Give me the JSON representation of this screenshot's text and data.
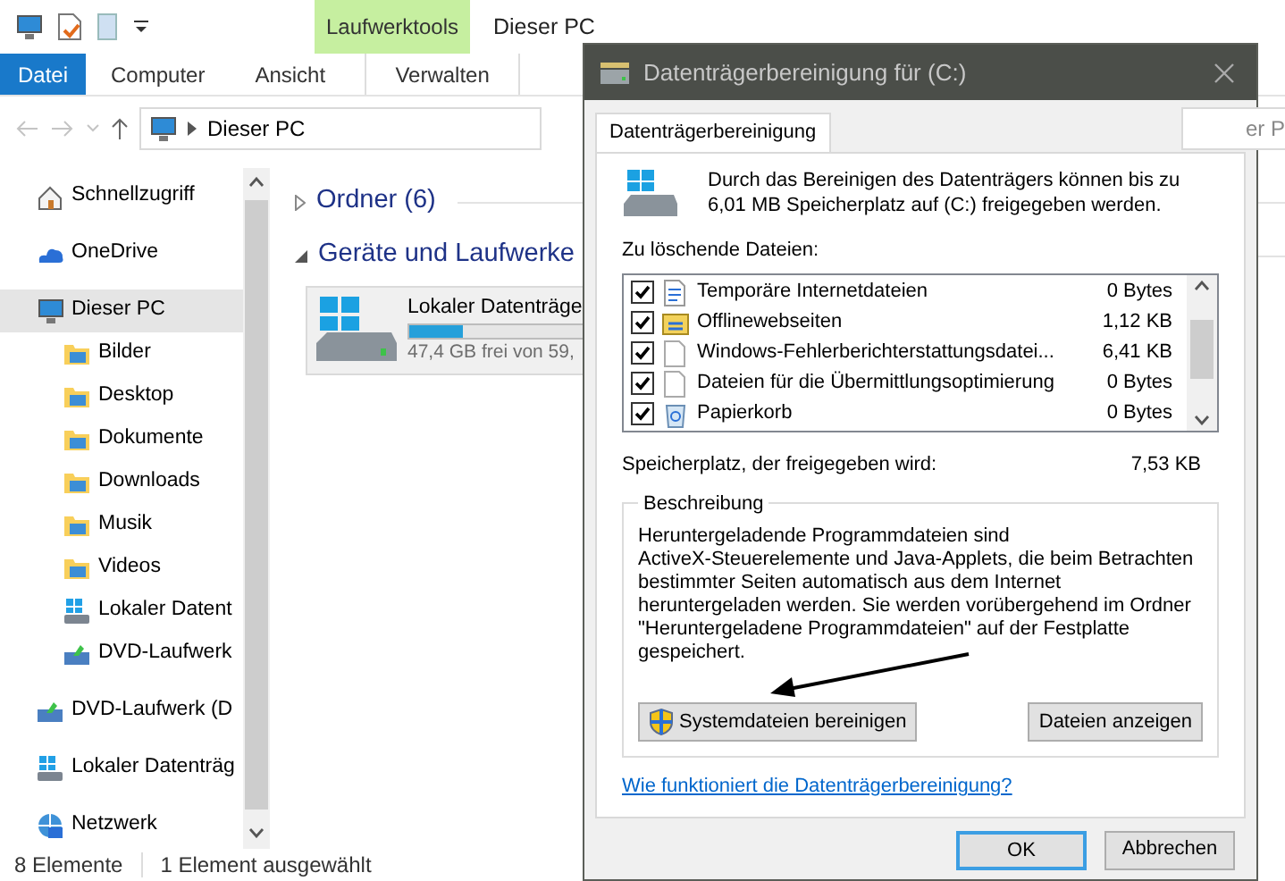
{
  "window": {
    "title": "Dieser PC",
    "contextual_tab": "Laufwerktools"
  },
  "ribbon_tabs": [
    {
      "label": "Datei",
      "kind": "file"
    },
    {
      "label": "Computer",
      "kind": "tab"
    },
    {
      "label": "Ansicht",
      "kind": "tab"
    },
    {
      "label": "Verwalten",
      "kind": "contextual"
    }
  ],
  "address": {
    "path": "Dieser PC"
  },
  "search": {
    "value": "er P"
  },
  "sidebar": {
    "items": [
      {
        "label": "Schnellzugriff",
        "kind": "home",
        "selected": false
      },
      {
        "label": "OneDrive",
        "kind": "cloud",
        "selected": false
      },
      {
        "label": "Dieser PC",
        "kind": "pc",
        "selected": true,
        "children": [
          {
            "label": "Bilder",
            "kind": "folder",
            "selected": false
          },
          {
            "label": "Desktop",
            "kind": "folder",
            "selected": false
          },
          {
            "label": "Dokumente",
            "kind": "folder",
            "selected": false
          },
          {
            "label": "Downloads",
            "kind": "folder",
            "selected": false
          },
          {
            "label": "Musik",
            "kind": "folder",
            "selected": false
          },
          {
            "label": "Videos",
            "kind": "folder",
            "selected": false
          },
          {
            "label": "Lokaler Datent",
            "kind": "drive",
            "selected": false
          },
          {
            "label": "DVD-Laufwerk",
            "kind": "dvd",
            "selected": false
          }
        ]
      },
      {
        "label": "DVD-Laufwerk (D",
        "kind": "dvd",
        "selected": false
      },
      {
        "label": "Lokaler Datenträg",
        "kind": "drive",
        "selected": false
      },
      {
        "label": "Netzwerk",
        "kind": "network",
        "selected": false
      }
    ]
  },
  "content": {
    "groups": [
      {
        "title": "Ordner (6)",
        "expanded": false
      },
      {
        "title": "Geräte und Laufwerke",
        "expanded": true
      }
    ],
    "drives": [
      {
        "name": "Lokaler Datenträge",
        "free": "47,4 GB frei von 59,",
        "level": 0.2
      }
    ]
  },
  "status_bar": {
    "count": "8 Elemente",
    "selection": "1 Element ausgewählt"
  },
  "dialog": {
    "title": "Datenträgerbereinigung für  (C:)",
    "tabs": [
      {
        "label": "Datenträgerbereinigung",
        "selected": true
      }
    ],
    "intro": "Durch das Bereinigen des Datenträgers können bis zu 6,01 MB Speicherplatz auf  (C:) freigegeben werden.",
    "files_label": "Zu löschende Dateien:",
    "files": [
      {
        "name": "Temporäre Internetdateien",
        "size": "0 Bytes",
        "checked": true,
        "kind": "web"
      },
      {
        "name": "Offlinewebseiten",
        "size": "1,12 KB",
        "checked": true,
        "kind": "offline"
      },
      {
        "name": "Windows-Fehlerberichterstattungsdatei...",
        "size": "6,41 KB",
        "checked": true,
        "kind": "file"
      },
      {
        "name": "Dateien für die Übermittlungsoptimierung",
        "size": "0 Bytes",
        "checked": true,
        "kind": "file"
      },
      {
        "name": "Papierkorb",
        "size": "0 Bytes",
        "checked": true,
        "kind": "bin"
      }
    ],
    "total_label": "Speicherplatz, der freigegeben wird:",
    "total": "7,53 KB",
    "description": {
      "title": "Beschreibung",
      "text": "Heruntergeladende Programmdateien sind\nActiveX-Steuerelemente und Java-Applets, die beim Betrachten bestimmter Seiten automatisch aus dem Internet heruntergeladen werden. Sie werden vorübergehend im Ordner \"Heruntergeladene Programmdateien\" auf der Festplatte gespeichert."
    },
    "buttons": [
      {
        "label": "Systemdateien bereinigen",
        "kind": "shield"
      },
      {
        "label": "Dateien anzeigen",
        "kind": "plain"
      }
    ],
    "help_link": "Wie funktioniert die Datenträgerbereinigung?",
    "footer_buttons": [
      {
        "label": "OK",
        "default": true
      },
      {
        "label": "Abbrechen",
        "default": false
      }
    ]
  }
}
